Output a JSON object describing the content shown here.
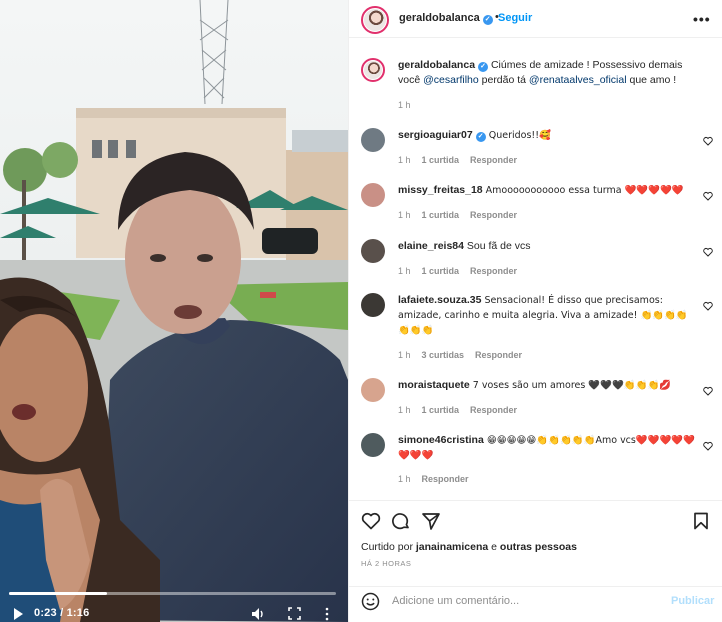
{
  "video": {
    "time": "0:23 / 1:16",
    "progress": 0.3
  },
  "header": {
    "username": "geraldobalanca",
    "separator": "•",
    "follow_label": "Seguir",
    "more_label": "•••"
  },
  "caption": {
    "username": "geraldobalanca",
    "text_before": " Ciúmes de amizade ! Possessivo demais você ",
    "mention1": "@cesarfilho",
    "text_mid": " perdão tá ",
    "mention2": "@renataalves_oficial",
    "text_after": " que amo !",
    "time": "1 h"
  },
  "comments": [
    {
      "username": "sergioaguiar07",
      "verified": true,
      "text": " Queridos!!🥰",
      "time": "1 h",
      "likes": "1 curtida",
      "reply": "Responder",
      "avatar_color": "#6f7a83"
    },
    {
      "username": "missy_freitas_18",
      "verified": false,
      "text": " Amooooooooooo essa turma ❤️❤️❤️❤️❤️",
      "time": "1 h",
      "likes": "1 curtida",
      "reply": "Responder",
      "avatar_color": "#c99086"
    },
    {
      "username": "elaine_reis84",
      "verified": false,
      "text": " Sou fã de vcs",
      "time": "1 h",
      "likes": "1 curtida",
      "reply": "Responder",
      "avatar_color": "#59504b"
    },
    {
      "username": "lafaiete.souza.35",
      "verified": false,
      "text": " Sensacional! É disso que precisamos: amizade, carinho e muita alegria. Viva a amizade! 👏👏👏👏👏👏👏",
      "time": "1 h",
      "likes": "3 curtidas",
      "reply": "Responder",
      "avatar_color": "#3b3834"
    },
    {
      "username": "moraistaquete",
      "verified": false,
      "text": " 7 voses são um amores 🖤🖤🖤👏👏👏💋",
      "time": "1 h",
      "likes": "1 curtida",
      "reply": "Responder",
      "avatar_color": "#d7a48e"
    },
    {
      "username": "simone46cristina",
      "verified": false,
      "text": " 😁😁😁😁😁👏👏👏👏👏Amo vcs❤️❤️❤️❤️❤️❤️❤️❤️",
      "time": "1 h",
      "likes": "",
      "reply": "Responder",
      "avatar_color": "#4f5b5e"
    }
  ],
  "actions": {
    "liked_by_prefix": "Curtido por ",
    "liked_by_user": "janainamicena",
    "liked_by_suffix": " e ",
    "liked_by_others": "outras pessoas",
    "time_ago": "HÁ 2 HORAS"
  },
  "add_comment": {
    "placeholder": "Adicione um comentário...",
    "publish_label": "Publicar"
  },
  "icons": {
    "play": "play-icon",
    "volume": "volume-icon",
    "fullscreen": "fullscreen-icon",
    "heart": "heart-icon",
    "comment": "comment-icon",
    "share": "share-icon",
    "bookmark": "bookmark-icon",
    "emoji": "smile-icon"
  },
  "colors": {
    "link": "#0095f6",
    "mention": "#00376b",
    "muted": "#8e8e8e",
    "verified": "#3897f0",
    "publish_disabled": "#b2dffc"
  }
}
